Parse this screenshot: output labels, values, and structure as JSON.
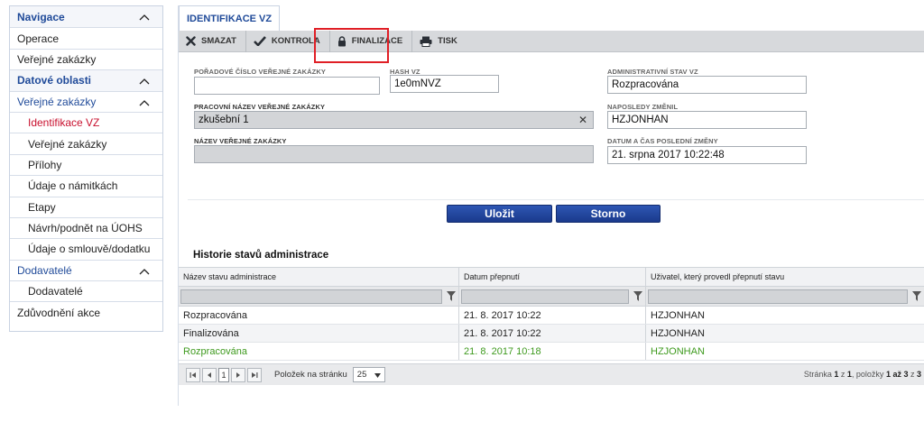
{
  "sidebar": {
    "items": [
      {
        "label": "Navigace",
        "type": "head"
      },
      {
        "label": "Operace",
        "type": "item"
      },
      {
        "label": "Veřejné zakázky",
        "type": "item"
      },
      {
        "label": "Datové oblasti",
        "type": "head"
      },
      {
        "label": "Veřejné zakázky",
        "type": "subhead"
      },
      {
        "label": "Identifikace VZ",
        "type": "active"
      },
      {
        "label": "Veřejné zakázky",
        "type": "sub"
      },
      {
        "label": "Přílohy",
        "type": "sub"
      },
      {
        "label": "Údaje o námitkách",
        "type": "sub"
      },
      {
        "label": "Etapy",
        "type": "sub"
      },
      {
        "label": "Návrh/podnět na ÚOHS",
        "type": "sub"
      },
      {
        "label": "Údaje o smlouvě/dodatku",
        "type": "sub"
      },
      {
        "label": "Dodavatelé",
        "type": "subhead"
      },
      {
        "label": "Dodavatelé",
        "type": "sub"
      },
      {
        "label": "Zdůvodnění akce",
        "type": "item"
      }
    ]
  },
  "tab": {
    "label": "IDENTIFIKACE VZ"
  },
  "toolbar": {
    "delete_label": "SMAZAT",
    "check_label": "KONTROLA",
    "finalize_label": "FINALIZACE",
    "print_label": "TISK"
  },
  "form": {
    "order_label": "POŘADOVÉ ČÍSLO VEŘEJNÉ ZAKÁZKY",
    "order_value": "",
    "hash_label": "HASH VZ",
    "hash_value": "1e0mNVZ",
    "admin_state_label": "ADMINISTRATIVNÍ STAV VZ",
    "admin_state_value": "Rozpracována",
    "working_name_label": "PRACOVNÍ NÁZEV VEŘEJNÉ ZAKÁZKY",
    "working_name_value": "zkušební 1",
    "last_changed_label": "NAPOSLEDY ZMĚNIL",
    "last_changed_value": "HZJONHAN",
    "name_label": "NÁZEV VEŘEJNÉ ZAKÁZKY",
    "name_value": "",
    "datetime_label": "DATUM A ČAS POSLEDNÍ ZMĚNY",
    "datetime_value": "21. srpna 2017 10:22:48"
  },
  "actions": {
    "save_label": "Uložit",
    "cancel_label": "Storno"
  },
  "history": {
    "title": "Historie stavů administrace",
    "columns": [
      "Název stavu administrace",
      "Datum přepnutí",
      "Uživatel, který provedl přepnutí stavu"
    ],
    "rows": [
      [
        "Rozpracována",
        "21. 8. 2017 10:22",
        "HZJONHAN"
      ],
      [
        "Finalizována",
        "21. 8. 2017 10:22",
        "HZJONHAN"
      ],
      [
        "Rozpracována",
        "21. 8. 2017 10:18",
        "HZJONHAN"
      ]
    ]
  },
  "pager": {
    "current_page": "1",
    "per_page_label": "Položek na stránku",
    "per_page_value": "25",
    "info_prefix": "Stránka ",
    "info_page": "1",
    "info_mid1": " z ",
    "info_pages": "1",
    "info_mid2": ", položky ",
    "info_range": "1 až 3",
    "info_mid3": " z ",
    "info_total": "3"
  },
  "colors": {
    "accent": "#1f4a99",
    "active": "#c8102e",
    "highlight": "#e01f26",
    "green": "#3e9a1e"
  }
}
